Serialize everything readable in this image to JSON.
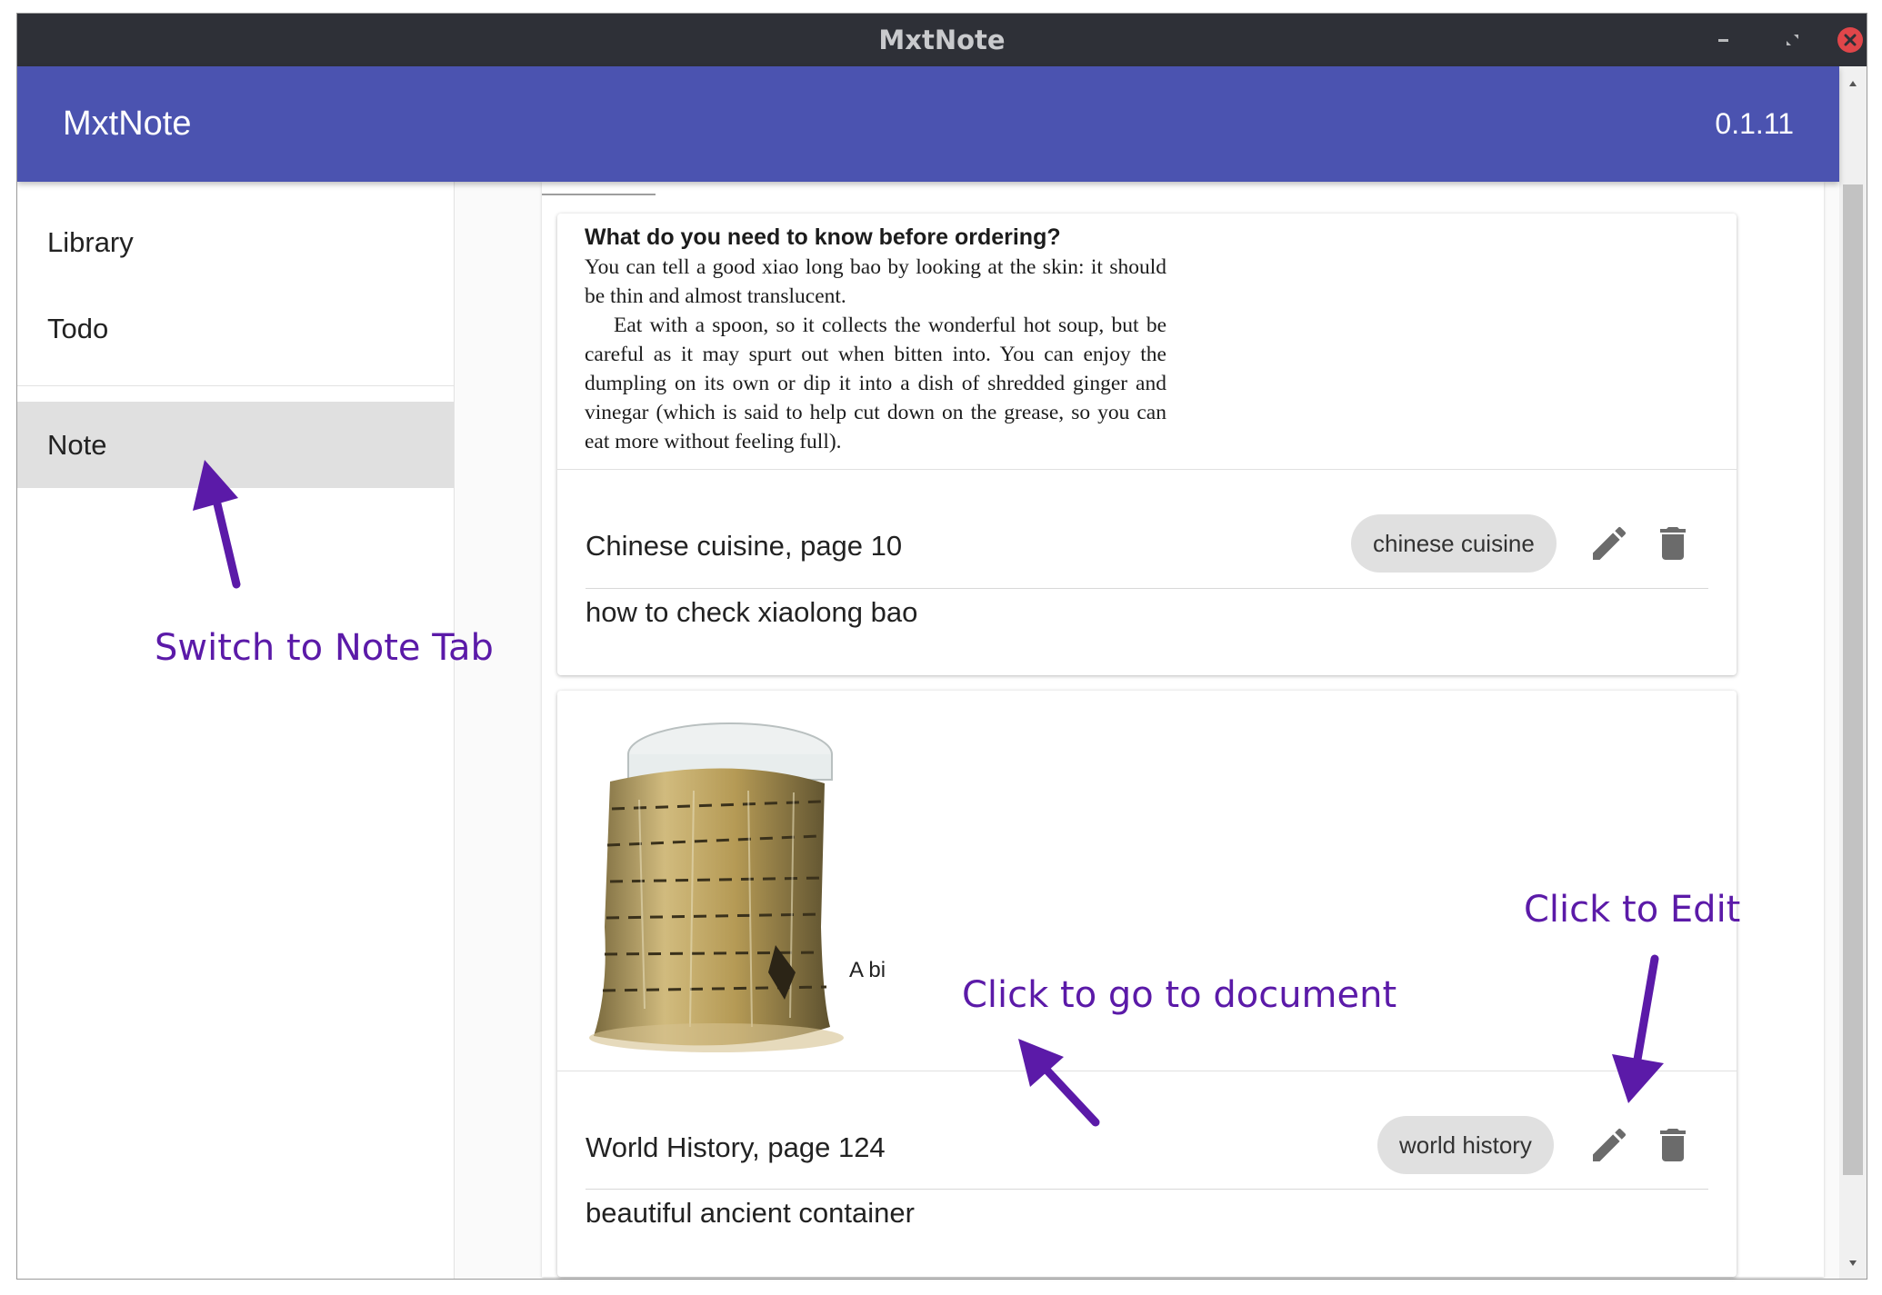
{
  "window": {
    "title": "MxtNote"
  },
  "appbar": {
    "title": "MxtNote",
    "version": "0.1.11"
  },
  "sidebar": {
    "items": [
      {
        "label": "Library"
      },
      {
        "label": "Todo"
      },
      {
        "label": "Note"
      }
    ],
    "active": "Note"
  },
  "notes": [
    {
      "excerpt": {
        "heading": "What do you need to know before ordering?",
        "para1": "You can tell a good xiao long bao by looking at the skin: it should be thin and almost translucent.",
        "para2": "Eat with a spoon, so it collects the wonderful hot soup, but be careful as it may spurt out when bitten into. You can enjoy the dumpling on its own or dip it into a dish of shredded ginger and vinegar (which is said to help cut down on the grease, so you can eat more without feeling full)."
      },
      "source": "Chinese cuisine, page 10",
      "tag": "chinese cuisine",
      "text": "how to check xiaolong bao"
    },
    {
      "image_caption": "A bi",
      "source": "World History, page 124",
      "tag": "world history",
      "text": "beautiful ancient container"
    }
  ],
  "annotations": {
    "note_tab": "Switch to Note Tab",
    "edit": "Click to Edit",
    "go_document": "Click to go to document"
  },
  "colors": {
    "appbar": "#4b53b0",
    "annotation": "#5b1aa8",
    "titlebar": "#2e3037",
    "close": "#e0464a"
  },
  "icons": [
    "minimize-icon",
    "restore-icon",
    "close-icon",
    "pencil-icon",
    "trash-icon"
  ]
}
